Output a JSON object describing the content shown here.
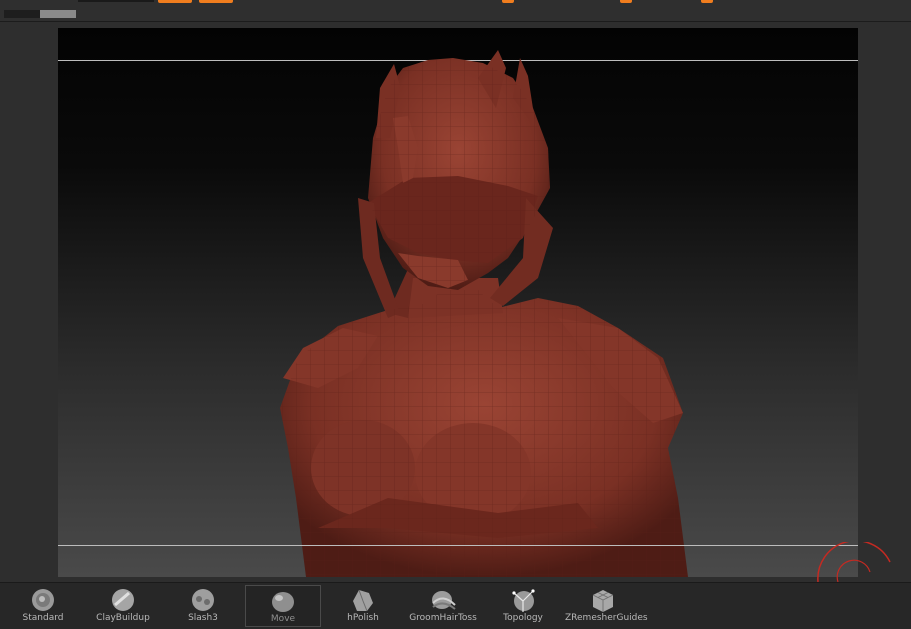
{
  "colors": {
    "accent": "#f07d1e",
    "model": "#7a3024",
    "panel": "#2b2b2b",
    "ring": "#c42a22"
  },
  "brush_shelf": {
    "items": [
      {
        "label": "Standard",
        "icon": "standard-brush-icon"
      },
      {
        "label": "ClayBuildup",
        "icon": "claybuildup-brush-icon"
      },
      {
        "label": "Slash3",
        "icon": "slash3-brush-icon"
      },
      {
        "label": "Move",
        "icon": "move-brush-icon",
        "selected": true
      },
      {
        "label": "hPolish",
        "icon": "hpolish-brush-icon"
      },
      {
        "label": "GroomHairToss",
        "icon": "groomhairtoss-brush-icon"
      },
      {
        "label": "Topology",
        "icon": "topology-brush-icon"
      },
      {
        "label": "ZRemesherGuides",
        "icon": "zremesherguides-brush-icon"
      }
    ]
  }
}
